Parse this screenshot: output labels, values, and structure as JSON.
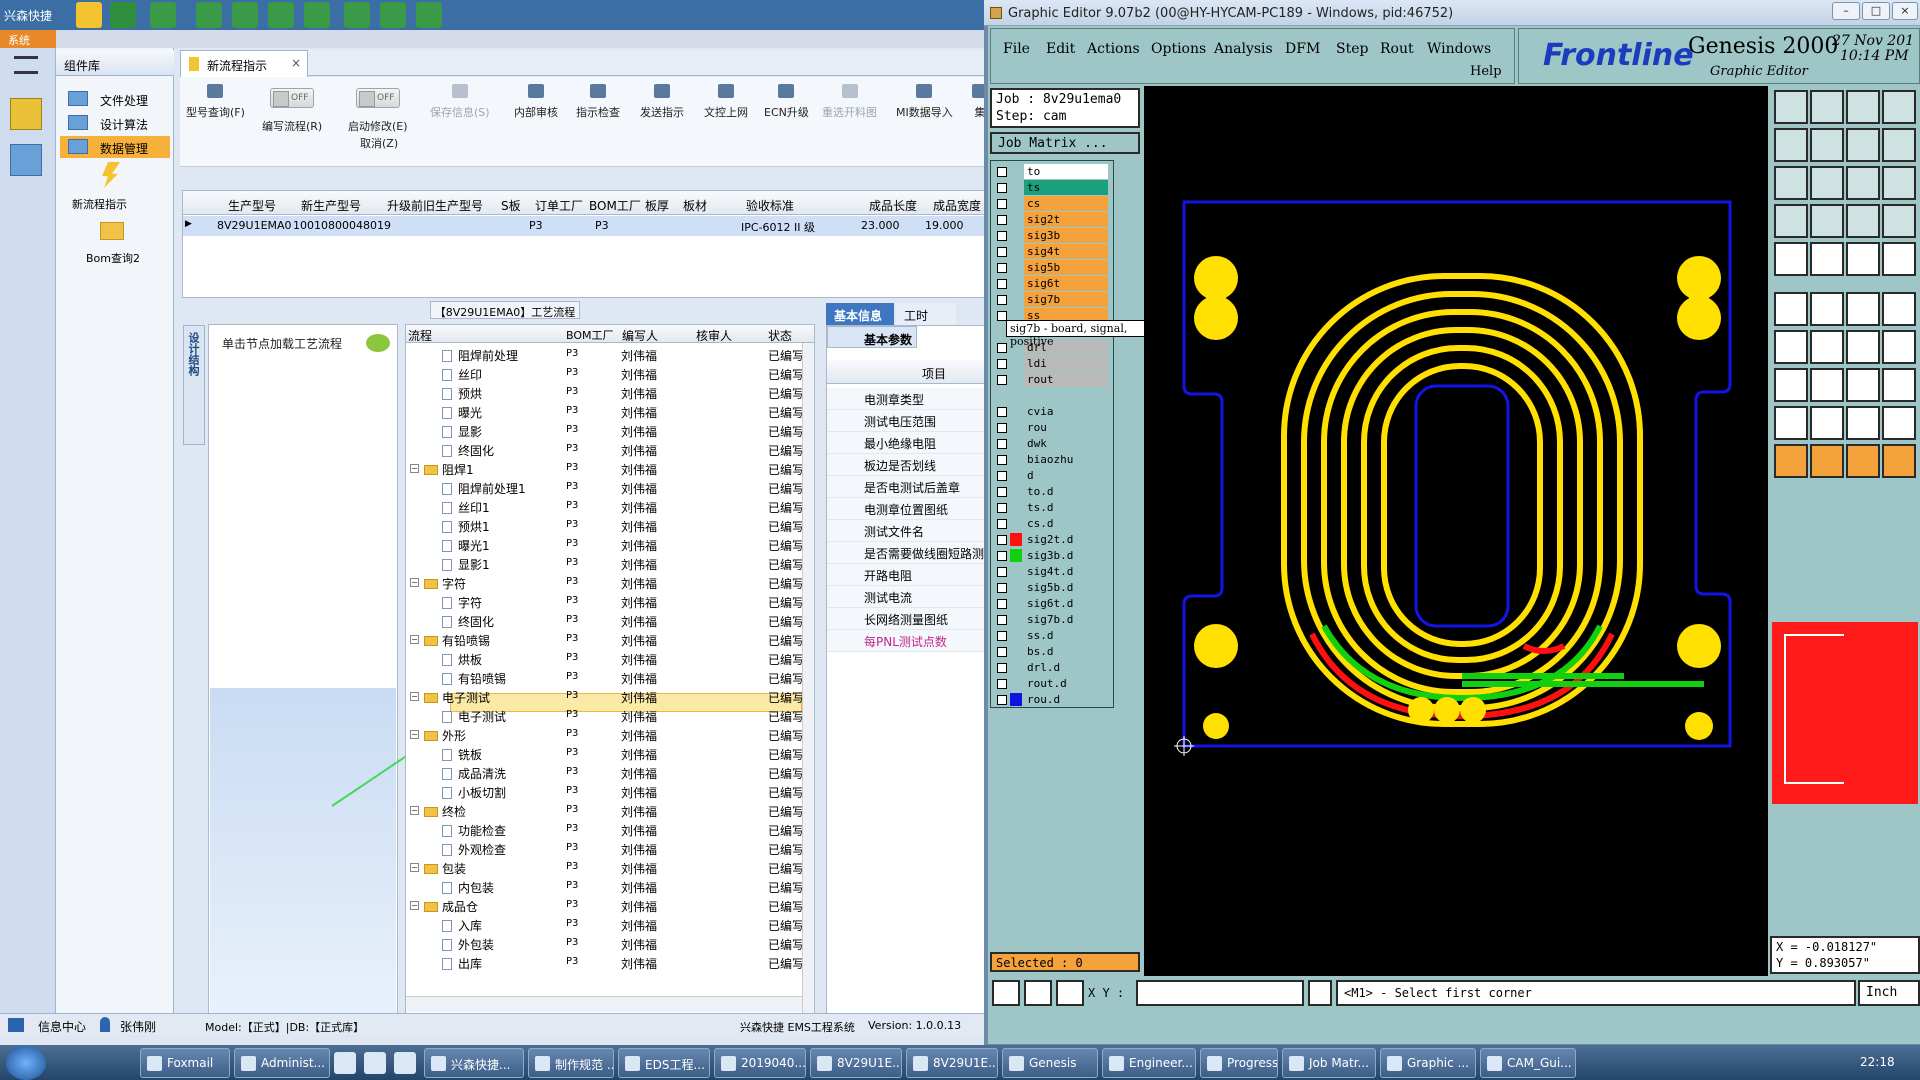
{
  "app": {
    "taskbar_brand": "兴森快捷",
    "menu_tag": "系统",
    "component_panel_title": "组件库",
    "component_items": [
      "文件处理",
      "设计算法",
      "数据管理"
    ],
    "component_shortcuts": [
      "新流程指示",
      "Bom查询2"
    ],
    "active_tab": "新流程指示",
    "toolbar": [
      {
        "label": "型号查询(F)",
        "enabled": true
      },
      {
        "label": "编写流程(R)",
        "enabled": true,
        "toggle": "OFF"
      },
      {
        "label": "启动修改(E)",
        "enabled": true,
        "toggle": "OFF"
      },
      {
        "label": "取消(Z)",
        "enabled": true
      },
      {
        "label": "保存信息(S)",
        "enabled": false
      },
      {
        "label": "内部审核",
        "enabled": true
      },
      {
        "label": "指示检查",
        "enabled": true
      },
      {
        "label": "发送指示",
        "enabled": true
      },
      {
        "label": "文控上网",
        "enabled": true
      },
      {
        "label": "ECN升级",
        "enabled": true
      },
      {
        "label": "重选开料图",
        "enabled": false
      },
      {
        "label": "MI数据导入",
        "enabled": true
      },
      {
        "label": "集",
        "enabled": true
      }
    ],
    "grid": {
      "headers": [
        "生产型号",
        "新生产型号",
        "升级前旧生产型号",
        "S板",
        "订单工厂",
        "BOM工厂",
        "板厚",
        "板材",
        "验收标准",
        "成品长度",
        "成品宽度"
      ],
      "row": [
        "8V29U1EMA0",
        "10010800048019",
        "",
        "",
        "P3",
        "P3",
        "",
        "",
        "IPC-6012 II 级",
        "23.000",
        "19.000"
      ]
    },
    "process_title": "【8V29U1EMA0】工艺流程",
    "vertical_tab": "设计结构",
    "load_tip": "单击节点加载工艺流程",
    "tree_headers": [
      "流程",
      "BOM工厂",
      "编写人",
      "核审人",
      "状态"
    ],
    "tree_rows": [
      {
        "name": "阻焊前处理",
        "level": 2,
        "type": "doc"
      },
      {
        "name": "丝印",
        "level": 2,
        "type": "doc"
      },
      {
        "name": "预烘",
        "level": 2,
        "type": "doc"
      },
      {
        "name": "曝光",
        "level": 2,
        "type": "doc"
      },
      {
        "name": "显影",
        "level": 2,
        "type": "doc"
      },
      {
        "name": "终固化",
        "level": 2,
        "type": "doc"
      },
      {
        "name": "阻焊1",
        "level": 1,
        "type": "folder"
      },
      {
        "name": "阻焊前处理1",
        "level": 2,
        "type": "doc"
      },
      {
        "name": "丝印1",
        "level": 2,
        "type": "doc"
      },
      {
        "name": "预烘1",
        "level": 2,
        "type": "doc"
      },
      {
        "name": "曝光1",
        "level": 2,
        "type": "doc"
      },
      {
        "name": "显影1",
        "level": 2,
        "type": "doc"
      },
      {
        "name": "字符",
        "level": 1,
        "type": "folder"
      },
      {
        "name": "字符",
        "level": 2,
        "type": "doc"
      },
      {
        "name": "终固化",
        "level": 2,
        "type": "doc"
      },
      {
        "name": "有铅喷锡",
        "level": 1,
        "type": "folder"
      },
      {
        "name": "烘板",
        "level": 2,
        "type": "doc"
      },
      {
        "name": "有铅喷锡",
        "level": 2,
        "type": "doc"
      },
      {
        "name": "电子测试",
        "level": 1,
        "type": "folder"
      },
      {
        "name": "电子测试",
        "level": 2,
        "type": "doc",
        "selected": true
      },
      {
        "name": "外形",
        "level": 1,
        "type": "folder"
      },
      {
        "name": "铣板",
        "level": 2,
        "type": "doc"
      },
      {
        "name": "成品清洗",
        "level": 2,
        "type": "doc"
      },
      {
        "name": "小板切割",
        "level": 2,
        "type": "doc"
      },
      {
        "name": "终检",
        "level": 1,
        "type": "folder"
      },
      {
        "name": "功能检查",
        "level": 2,
        "type": "doc"
      },
      {
        "name": "外观检查",
        "level": 2,
        "type": "doc"
      },
      {
        "name": "包装",
        "level": 1,
        "type": "folder"
      },
      {
        "name": "内包装",
        "level": 2,
        "type": "doc"
      },
      {
        "name": "成品仓",
        "level": 1,
        "type": "folder"
      },
      {
        "name": "入库",
        "level": 2,
        "type": "doc"
      },
      {
        "name": "外包装",
        "level": 2,
        "type": "doc"
      },
      {
        "name": "出库",
        "level": 2,
        "type": "doc"
      }
    ],
    "tree_row_values": {
      "bom": "P3",
      "writer": "刘伟福",
      "status": "已编写"
    },
    "info_tabs": [
      "基本信息",
      "工时"
    ],
    "info_subtab": "基本参数",
    "info_col_head": "项目",
    "info_items": [
      "电测章类型",
      "测试电压范围",
      "最小绝缘电阻",
      "板边是否划线",
      "是否电测试后盖章",
      "电测章位置图纸",
      "测试文件名",
      "是否需要做线圈短路测",
      "开路电阻",
      "测试电流",
      "长网络测量图纸",
      "每PNL测试点数"
    ],
    "status": {
      "center": "信息中心",
      "user": "张伟刚",
      "model": "Model:【正式】|DB:【正式库】",
      "system": "兴森快捷 EMS工程系统",
      "version": "Version: 1.0.0.13"
    }
  },
  "genesis": {
    "title": "Graphic Editor 9.07b2 (00@HY-HYCAM-PC189 - Windows, pid:46752)",
    "menu": [
      "File",
      "Edit",
      "Actions",
      "Options",
      "Analysis",
      "DFM",
      "Step",
      "Rout",
      "Windows"
    ],
    "help": "Help",
    "brand": "Frontline",
    "product": "Genesis 2000",
    "subtitle": "Graphic Editor",
    "date": "27 Nov 201",
    "time": "10:14 PM",
    "job": "Job  : 8v29u1ema0",
    "step": "Step: cam",
    "job_matrix": "Job Matrix ...",
    "tooltip": "sig7b - board, signal, positive",
    "layers": [
      {
        "name": "to",
        "color": "#ffffff",
        "swatch": ""
      },
      {
        "name": "ts",
        "color": "#1aa07c",
        "swatch": ""
      },
      {
        "name": "cs",
        "color": "#f4a23b",
        "swatch": ""
      },
      {
        "name": "sig2t",
        "color": "#f4a23b",
        "swatch": ""
      },
      {
        "name": "sig3b",
        "color": "#f4a23b",
        "swatch": ""
      },
      {
        "name": "sig4t",
        "color": "#f4a23b",
        "swatch": ""
      },
      {
        "name": "sig5b",
        "color": "#f4a23b",
        "swatch": ""
      },
      {
        "name": "sig6t",
        "color": "#f4a23b",
        "swatch": ""
      },
      {
        "name": "sig7b",
        "color": "#f4a23b",
        "swatch": ""
      },
      {
        "name": "ss",
        "color": "#f4a23b",
        "swatch": ""
      },
      {
        "name": "",
        "color": "#9ec6c6",
        "swatch": ""
      },
      {
        "name": "drl",
        "color": "#b9b9b9",
        "swatch": ""
      },
      {
        "name": "ldi",
        "color": "#b9b9b9",
        "swatch": ""
      },
      {
        "name": "rout",
        "color": "#b9b9b9",
        "swatch": ""
      },
      {
        "name": "",
        "color": "#9ec6c6",
        "swatch": ""
      },
      {
        "name": "cvia",
        "color": "#9ec6c6",
        "swatch": ""
      },
      {
        "name": "rou",
        "color": "#9ec6c6",
        "swatch": ""
      },
      {
        "name": "dwk",
        "color": "#9ec6c6",
        "swatch": ""
      },
      {
        "name": "biaozhu",
        "color": "#9ec6c6",
        "swatch": ""
      },
      {
        "name": "d",
        "color": "#9ec6c6",
        "swatch": ""
      },
      {
        "name": "to.d",
        "color": "#9ec6c6",
        "swatch": ""
      },
      {
        "name": "ts.d",
        "color": "#9ec6c6",
        "swatch": ""
      },
      {
        "name": "cs.d",
        "color": "#9ec6c6",
        "swatch": ""
      },
      {
        "name": "sig2t.d",
        "color": "#9ec6c6",
        "swatch": "#ff1010"
      },
      {
        "name": "sig3b.d",
        "color": "#9ec6c6",
        "swatch": "#10d010"
      },
      {
        "name": "sig4t.d",
        "color": "#9ec6c6",
        "swatch": ""
      },
      {
        "name": "sig5b.d",
        "color": "#9ec6c6",
        "swatch": ""
      },
      {
        "name": "sig6t.d",
        "color": "#9ec6c6",
        "swatch": ""
      },
      {
        "name": "sig7b.d",
        "color": "#9ec6c6",
        "swatch": ""
      },
      {
        "name": "ss.d",
        "color": "#9ec6c6",
        "swatch": ""
      },
      {
        "name": "bs.d",
        "color": "#9ec6c6",
        "swatch": ""
      },
      {
        "name": "drl.d",
        "color": "#9ec6c6",
        "swatch": ""
      },
      {
        "name": "rout.d",
        "color": "#9ec6c6",
        "swatch": ""
      },
      {
        "name": "rou.d",
        "color": "#9ec6c6",
        "swatch": "#1010e0"
      }
    ],
    "selected": "Selected : 0",
    "x": "X = -0.018127\"",
    "y": "Y = 0.893057\"",
    "xy_label": "X Y :",
    "prompt": "<M1> - Select first corner",
    "unit": "Inch",
    "board_colors": {
      "outline": "#1414e6",
      "pad": "#ffe000",
      "trace_green": "#10d010",
      "trace_red": "#ff1010"
    }
  },
  "taskbar": {
    "items": [
      "Foxmail",
      "Administ...",
      "",
      "",
      "",
      "兴森快捷...",
      "制作规范 ...",
      "EDS工程...",
      "2019040...",
      "8V29U1E...",
      "8V29U1E...",
      "Genesis",
      "Engineer...",
      "Progress",
      "Job Matr...",
      "Graphic ...",
      "CAM_Gui..."
    ],
    "clock": "22:18"
  }
}
